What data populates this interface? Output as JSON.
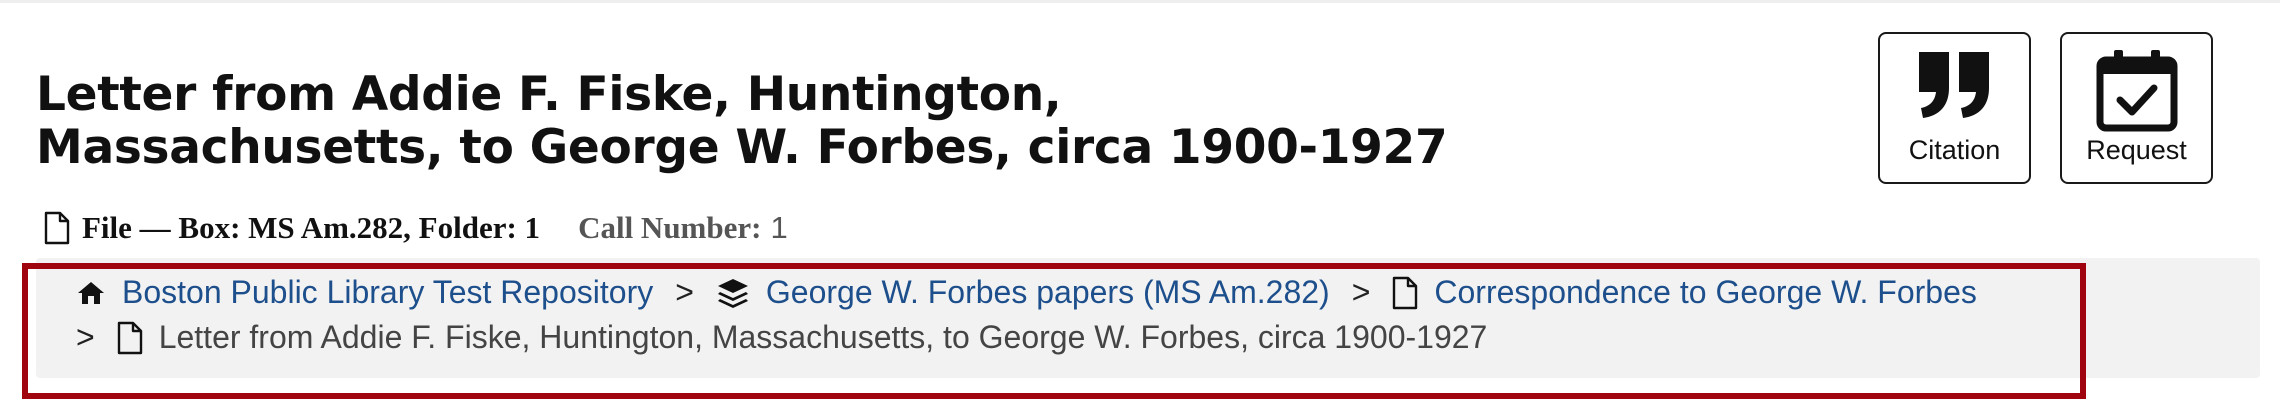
{
  "record": {
    "title_line1": "Letter from Addie F. Fiske, Huntington,",
    "title_line2": "Massachusetts, to George W. Forbes, circa 1900-1927",
    "level_box": "File — Box: MS Am.282, Folder: 1",
    "call_number_label": "Call Number:",
    "call_number_value": "1"
  },
  "actions": {
    "citation_label": "Citation",
    "request_label": "Request"
  },
  "breadcrumb": {
    "separator": ">",
    "items": [
      {
        "label": "Boston Public Library Test Repository",
        "icon": "home-icon"
      },
      {
        "label": "George W. Forbes papers (MS Am.282)",
        "icon": "layers-icon"
      },
      {
        "label": "Correspondence to George W. Forbes",
        "icon": "file-icon"
      },
      {
        "label": "Letter from Addie F. Fiske, Huntington, Massachusetts, to George W. Forbes, circa 1900-1927",
        "icon": "file-icon"
      }
    ]
  },
  "colors": {
    "link": "#1d4f8c",
    "highlight_border": "#a0050f",
    "breadcrumb_background": "#f2f2f2"
  }
}
